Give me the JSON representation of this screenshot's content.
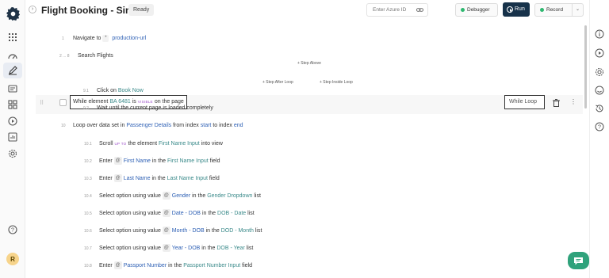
{
  "header": {
    "title": "Flight Booking - Sim...",
    "status": "Ready",
    "azure_placeholder": "Enter Azure ID",
    "debugger_label": "Debugger",
    "run_label": "Run",
    "record_label": "Record"
  },
  "sidebar": {
    "items": [
      "settings-logo",
      "apps",
      "dashboard",
      "editor",
      "runs",
      "grid",
      "play",
      "reports",
      "settings"
    ],
    "avatar_initial": "R"
  },
  "steps": [
    {
      "num": "1",
      "parts": [
        "Navigate to",
        "production-url"
      ]
    },
    {
      "num": "2 ... 8",
      "parts": [
        "Search Flights"
      ]
    },
    {
      "num": "9",
      "parts": [
        "While element",
        "BA 6481",
        "is",
        "VISIBLE",
        "on the page"
      ],
      "loop_tag": "While Loop"
    },
    {
      "num": "9.1",
      "parts": [
        "Click on",
        "Book Now"
      ]
    },
    {
      "num": "9.2",
      "parts": [
        "Wait until the current page is loaded completely"
      ]
    },
    {
      "num": "10",
      "parts": [
        "Loop over data set in",
        "Passenger Details",
        "from index",
        "start",
        "to index",
        "end"
      ]
    },
    {
      "num": "10.1",
      "parts": [
        "Scroll",
        "UP TO",
        "the element",
        "First Name Input",
        "into view"
      ]
    },
    {
      "num": "10.2",
      "parts": [
        "Enter",
        "First Name",
        "in the",
        "First Name Input",
        "field"
      ]
    },
    {
      "num": "10.3",
      "parts": [
        "Enter",
        "Last Name",
        "in the",
        "Last Name Input",
        "field"
      ]
    },
    {
      "num": "10.4",
      "parts": [
        "Select option using value",
        "Gender",
        "in the",
        "Gender Dropdown",
        "list"
      ]
    },
    {
      "num": "10.5",
      "parts": [
        "Select option using value",
        "Date - DOB",
        "in the",
        "DOB - Date",
        "list"
      ]
    },
    {
      "num": "10.6",
      "parts": [
        "Select option using value",
        "Month - DOB",
        "in the",
        "DOD - Month",
        "list"
      ]
    },
    {
      "num": "10.7",
      "parts": [
        "Select option using value",
        "Year - DOB",
        "in the",
        "DOB - Year",
        "list"
      ]
    },
    {
      "num": "10.8",
      "parts": [
        "Enter",
        "Passport Number",
        "in the",
        "Passport Number Input",
        "field"
      ]
    }
  ],
  "add_step": {
    "above": "+ Step Above",
    "after_loop": "+ Step After Loop",
    "inside_loop": "+ Step Inside Loop"
  },
  "at_symbol": "@",
  "step_symbol": "*"
}
